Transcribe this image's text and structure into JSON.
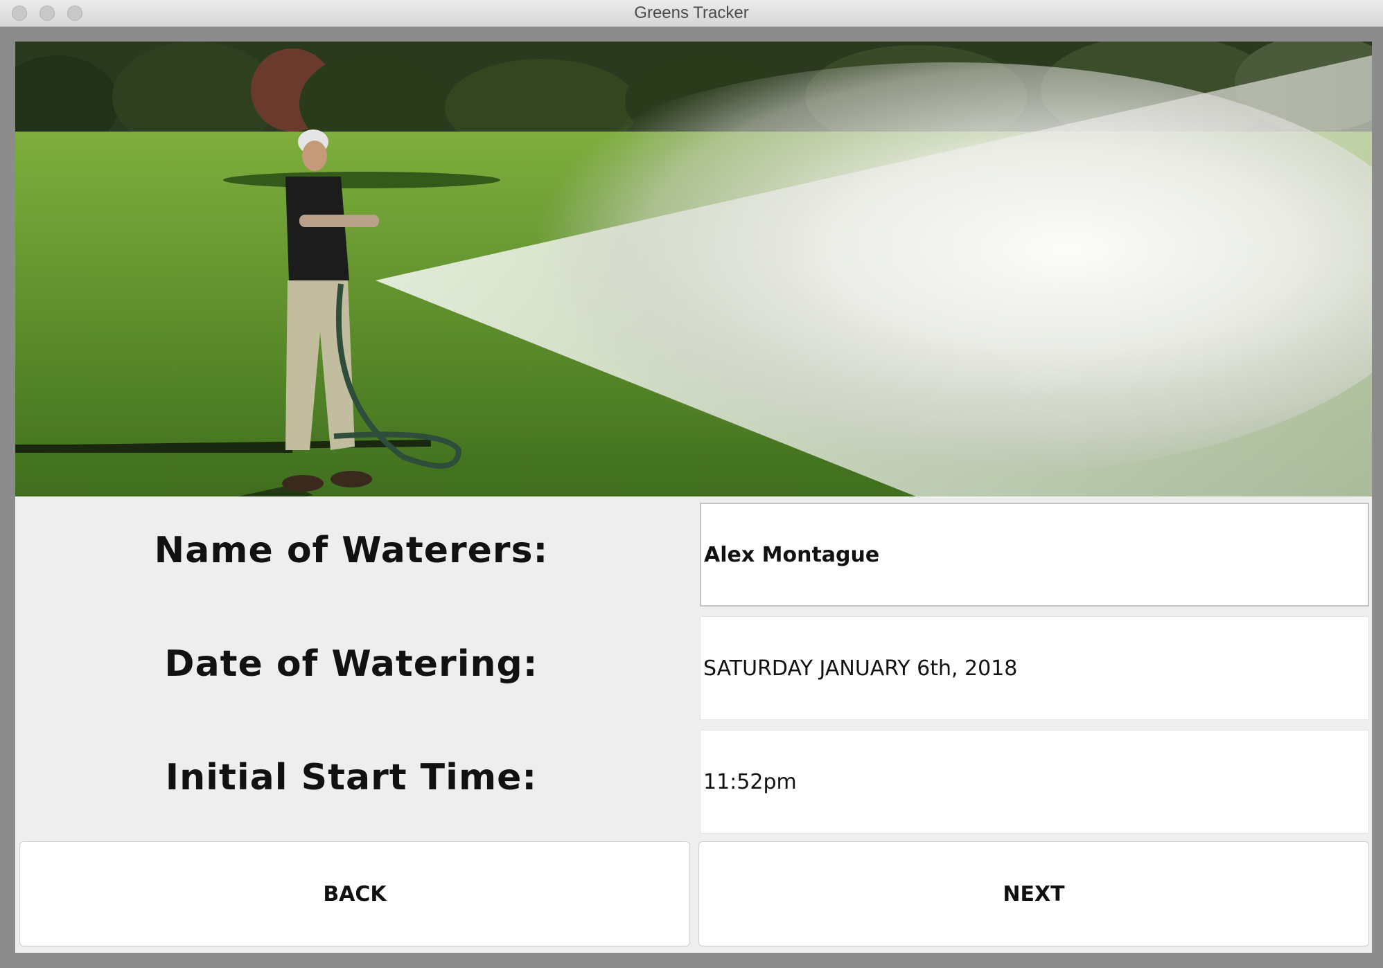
{
  "window": {
    "title": "Greens Tracker"
  },
  "banner": {
    "icon": "photo-golf-green-watering"
  },
  "form": {
    "waterers_label": "Name of Waterers:",
    "waterers_value": "Alex Montague",
    "date_label": "Date of Watering:",
    "date_value": "SATURDAY JANUARY 6th, 2018",
    "start_label": "Initial Start Time:",
    "start_value": "11:52pm"
  },
  "buttons": {
    "back_label": "BACK",
    "next_label": "NEXT"
  }
}
